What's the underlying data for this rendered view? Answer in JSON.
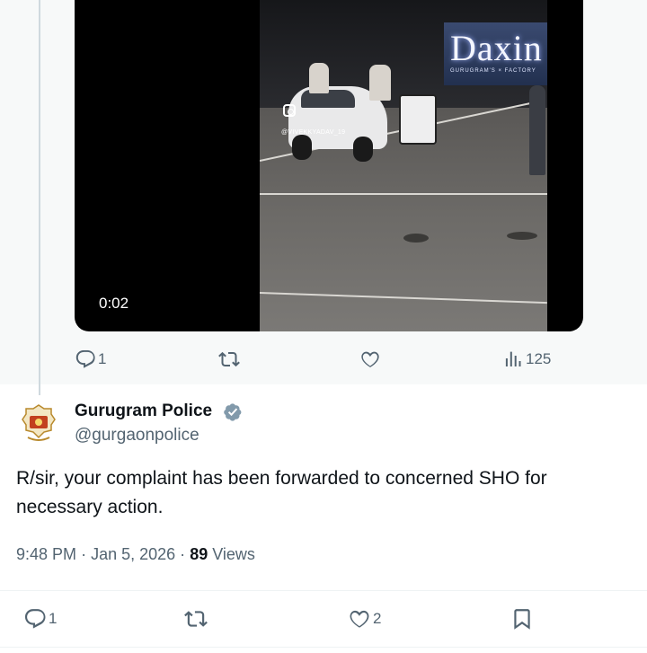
{
  "video": {
    "timestamp": "0:02",
    "overlay_brand": "Daxin",
    "overlay_subtext": "GURUGRAM'S × FACTORY",
    "watermark_handle": "@VIVEKKYADAV_19"
  },
  "previous_tweet": {
    "actions": {
      "replies": "1",
      "reposts": "",
      "likes": "",
      "views": "125"
    }
  },
  "tweet": {
    "author_name": "Gurugram Police",
    "verified": true,
    "handle": "@gurgaonpolice",
    "text": "R/sir, your complaint has been forwarded to concerned SHO for necessary action.",
    "time": "9:48 PM",
    "separator": "·",
    "date": "Jan 5, 2026",
    "views_count": "89",
    "views_label": "Views",
    "actions": {
      "replies": "1",
      "reposts": "",
      "likes": "2"
    }
  },
  "icons": [
    "reply-icon",
    "repost-icon",
    "like-icon",
    "views-icon",
    "bookmark-icon",
    "verified-badge-icon",
    "instagram-icon"
  ],
  "colors": {
    "text_primary": "#0f1419",
    "text_secondary": "#536471",
    "verified_badge": "#829aab",
    "thread_line": "#cfd9de",
    "background_top": "#f7f9f9"
  }
}
